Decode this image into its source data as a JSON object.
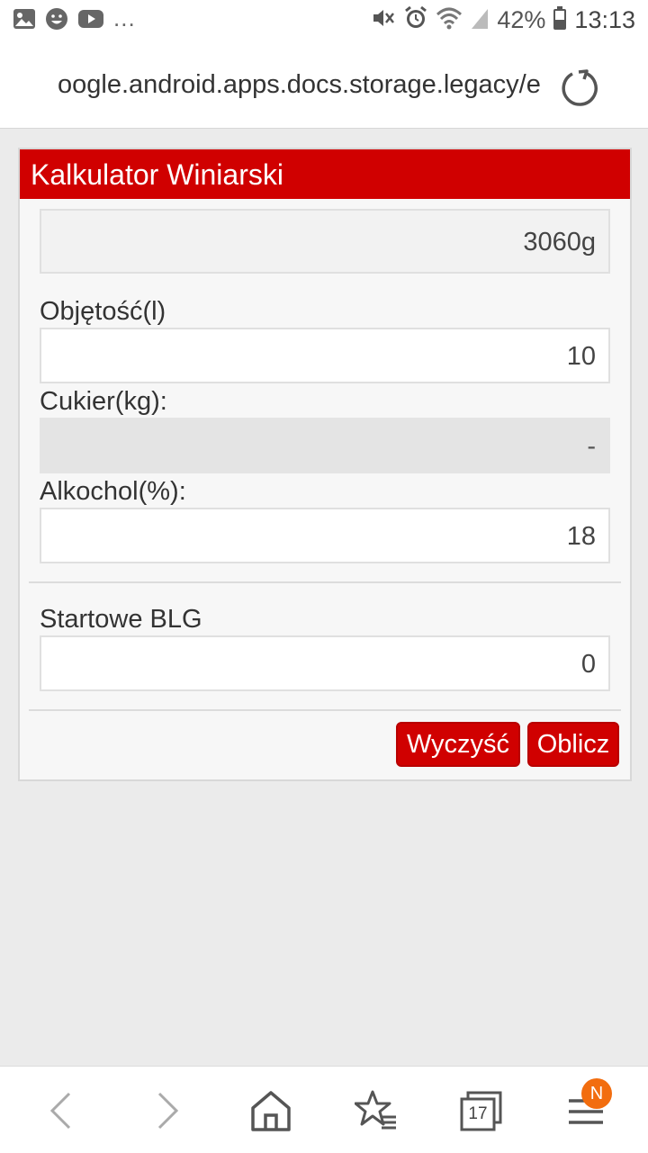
{
  "status_bar": {
    "notification_icons": [
      "image-icon",
      "face-icon",
      "youtube-icon"
    ],
    "more": "...",
    "battery_percent": "42%",
    "time": "13:13"
  },
  "url_bar": {
    "url": "oogle.android.apps.docs.storage.legacy/e"
  },
  "calculator": {
    "title": "Kalkulator Winiarski",
    "result_value": "3060g",
    "volume_label": "Objętość(l)",
    "volume_value": "10",
    "sugar_label": "Cukier(kg):",
    "sugar_value": "-",
    "alcohol_label": "Alkochol(%):",
    "alcohol_value": "18",
    "blg_label": "Startowe BLG",
    "blg_value": "0",
    "clear_button": "Wyczyść",
    "calculate_button": "Oblicz"
  },
  "bottom_nav": {
    "tabs_count": "17",
    "menu_badge": "N"
  },
  "colors": {
    "accent": "#d00000",
    "badge": "#f26d0f"
  }
}
